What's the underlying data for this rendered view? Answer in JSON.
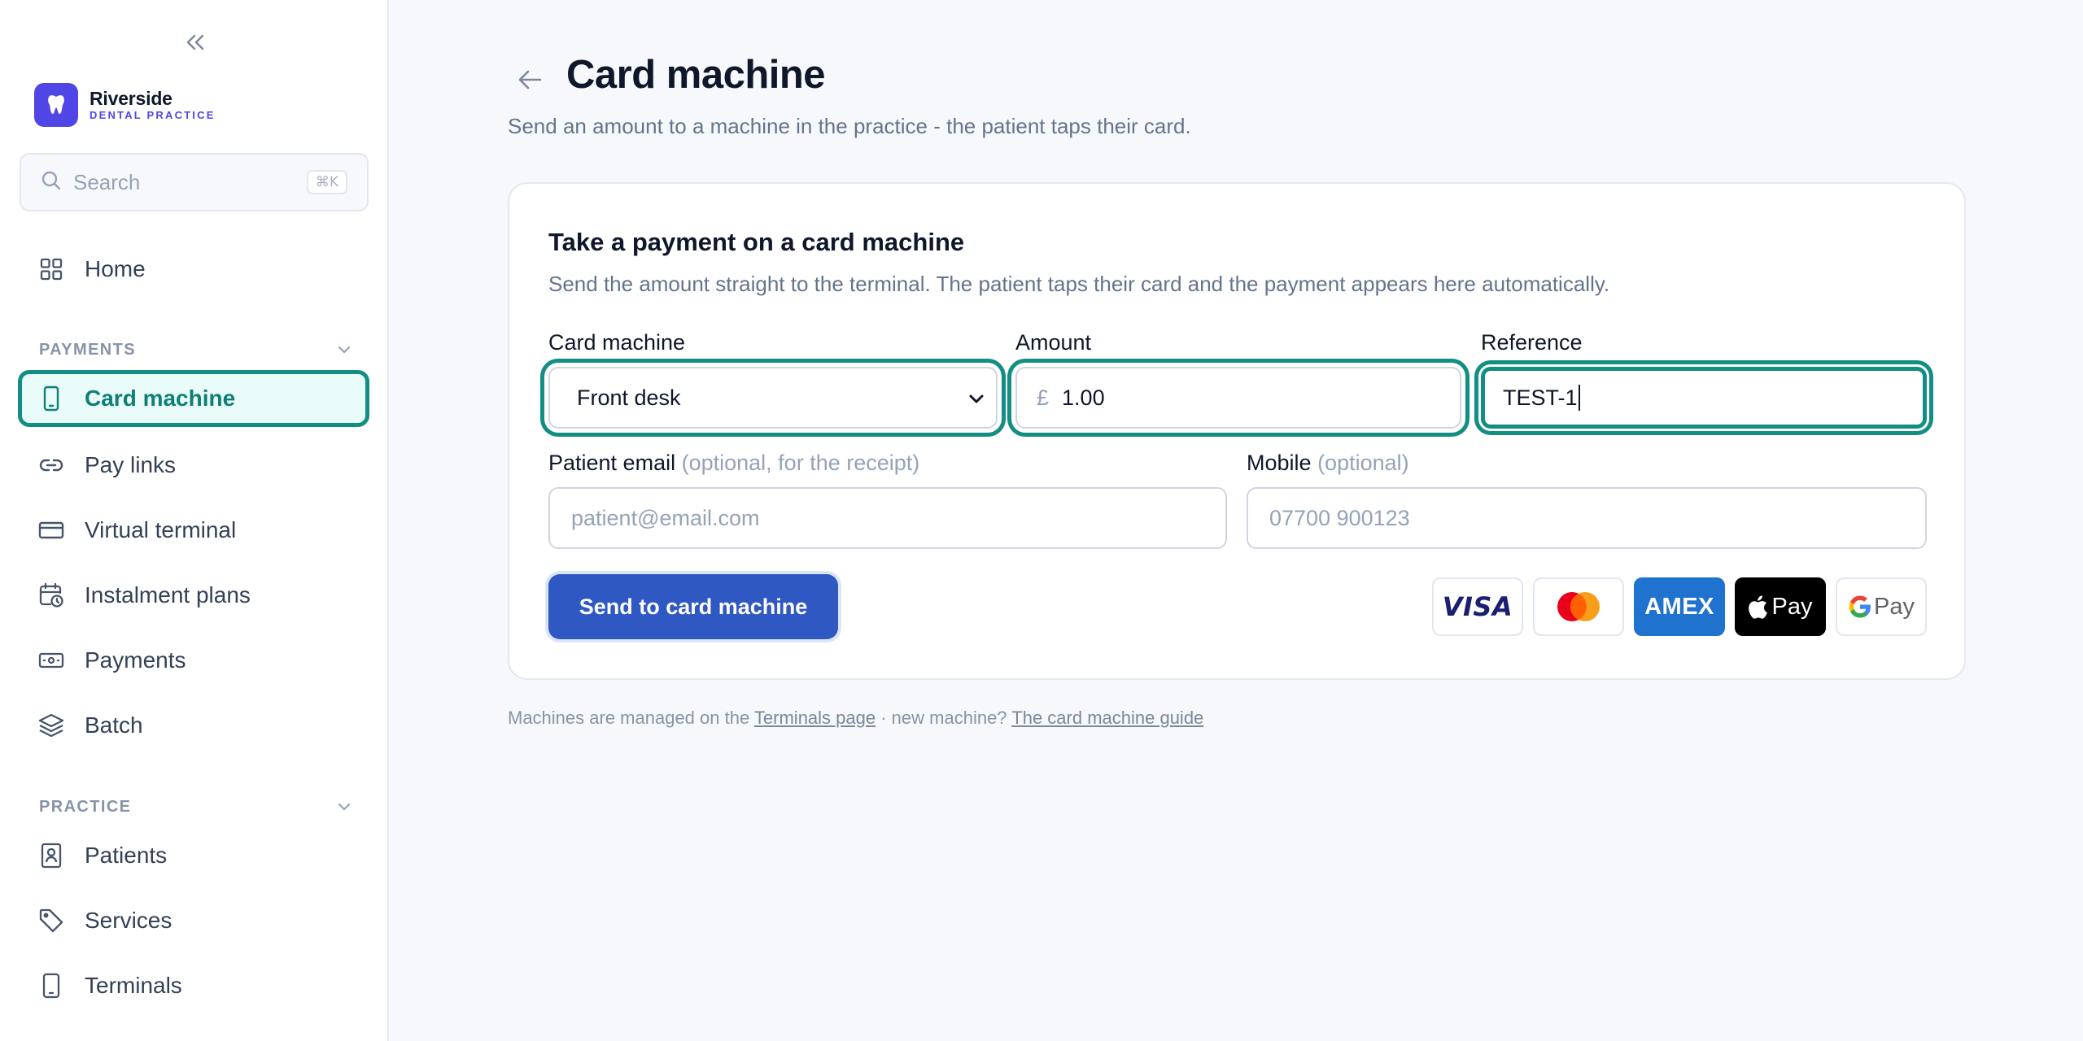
{
  "brand": {
    "name": "Riverside",
    "subtitle": "DENTAL PRACTICE",
    "color": "#4f46e5"
  },
  "sidebar": {
    "search": {
      "placeholder": "Search",
      "shortcut": "⌘K"
    },
    "home": {
      "label": "Home",
      "icon": "grid-icon"
    },
    "sections": [
      {
        "label": "PAYMENTS",
        "items": [
          {
            "label": "Card machine",
            "icon": "phone-icon",
            "active": true
          },
          {
            "label": "Pay links",
            "icon": "link-icon"
          },
          {
            "label": "Virtual terminal",
            "icon": "credit-card-icon"
          },
          {
            "label": "Instalment plans",
            "icon": "calendar-clock-icon"
          },
          {
            "label": "Payments",
            "icon": "banknote-icon"
          },
          {
            "label": "Batch",
            "icon": "layers-icon"
          }
        ]
      },
      {
        "label": "PRACTICE",
        "items": [
          {
            "label": "Patients",
            "icon": "contact-icon"
          },
          {
            "label": "Services",
            "icon": "tag-icon"
          },
          {
            "label": "Terminals",
            "icon": "tablet-icon"
          }
        ]
      }
    ]
  },
  "page": {
    "title": "Card machine",
    "subtitle": "Send an amount to a machine in the practice - the patient taps their card."
  },
  "card": {
    "title": "Take a payment on a card machine",
    "description": "Send the amount straight to the terminal. The patient taps their card and the payment appears here automatically.",
    "fields": {
      "machine": {
        "label": "Card machine",
        "value": "Front desk",
        "options": [
          "Front desk"
        ]
      },
      "amount": {
        "label": "Amount",
        "currency": "£",
        "value": "1.00"
      },
      "reference": {
        "label": "Reference",
        "value": "TEST-1"
      },
      "email": {
        "label": "Patient email",
        "hint": "(optional, for the receipt)",
        "placeholder": "patient@email.com"
      },
      "mobile": {
        "label": "Mobile",
        "hint": "(optional)",
        "placeholder": "07700 900123"
      }
    },
    "send_label": "Send to card machine",
    "payment_methods": [
      "VISA",
      "Mastercard",
      "AMEX",
      "Pay",
      "Pay"
    ]
  },
  "footnote": {
    "prefix": "Machines are managed on the",
    "link1": "Terminals page",
    "middle": "· new machine?",
    "link2": "The card machine guide"
  },
  "colors": {
    "accent": "#138e82",
    "primary": "#2f58c3",
    "amex": "#1f72cd"
  }
}
